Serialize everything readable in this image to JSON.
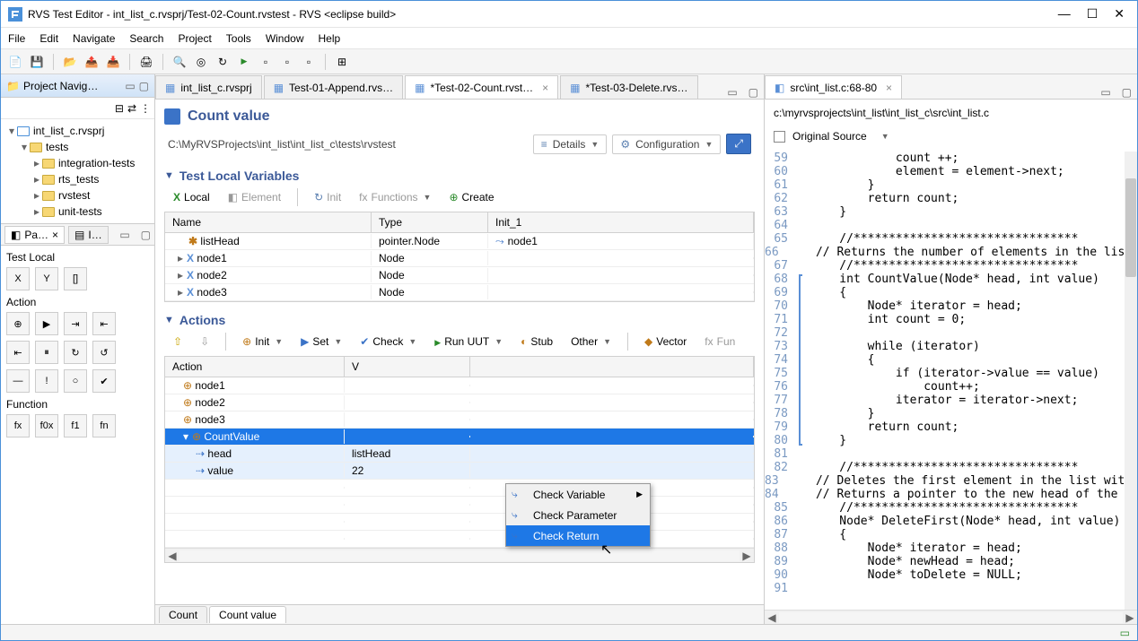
{
  "window": {
    "title": "RVS Test Editor - int_list_c.rvsprj/Test-02-Count.rvstest - RVS <eclipse build>"
  },
  "menu": [
    "File",
    "Edit",
    "Navigate",
    "Search",
    "Project",
    "Tools",
    "Window",
    "Help"
  ],
  "left_view": {
    "title": "Project Navig…",
    "tree": [
      {
        "level": 0,
        "exp": "▾",
        "icon": "proj",
        "label": "int_list_c.rvsprj"
      },
      {
        "level": 1,
        "exp": "▾",
        "icon": "folder",
        "label": "tests"
      },
      {
        "level": 2,
        "exp": "▸",
        "icon": "folder",
        "label": "integration-tests"
      },
      {
        "level": 2,
        "exp": "▸",
        "icon": "folder",
        "label": "rts_tests"
      },
      {
        "level": 2,
        "exp": "▸",
        "icon": "folder",
        "label": "rvstest"
      },
      {
        "level": 2,
        "exp": "▸",
        "icon": "folder",
        "label": "unit-tests"
      }
    ]
  },
  "lower_left": {
    "tabs": [
      {
        "label": "Pa…",
        "active": true
      },
      {
        "label": "I…",
        "active": false
      }
    ],
    "sections": {
      "test_local": "Test Local",
      "action": "Action",
      "function": "Function"
    },
    "row1": [
      "X",
      "Y",
      "[]"
    ],
    "row2": [
      "⊕",
      "▶",
      "⇥",
      "⇤"
    ],
    "row3": [
      "⇤",
      "⏸",
      "↻",
      "↺"
    ],
    "row4": [
      "—",
      "!",
      "○",
      "✔"
    ],
    "row5": [
      "fx",
      "f0x",
      "f1",
      "fn"
    ]
  },
  "editor_tabs": [
    {
      "label": "int_list_c.rvsprj",
      "active": false,
      "dirty": false
    },
    {
      "label": "Test-01-Append.rvs…",
      "active": false,
      "dirty": false
    },
    {
      "label": "*Test-02-Count.rvst…",
      "active": true,
      "dirty": true
    },
    {
      "label": "*Test-03-Delete.rvs…",
      "active": false,
      "dirty": true
    }
  ],
  "editor": {
    "title": "Count value",
    "path": "C:\\MyRVSProjects\\int_list\\int_list_c\\tests\\rvstest",
    "details_btn": "Details",
    "config_btn": "Configuration",
    "section_local": "Test Local Variables",
    "local_bar": {
      "local": "Local",
      "element": "Element",
      "init": "Init",
      "functions": "Functions",
      "create": "Create"
    },
    "local_cols": {
      "name": "Name",
      "type": "Type",
      "init": "Init_1"
    },
    "local_rows": [
      {
        "name": "listHead",
        "type": "pointer.Node",
        "init": "node1",
        "icon": "ptr"
      },
      {
        "name": "node1",
        "type": "Node",
        "init": "",
        "icon": "node",
        "exp": "▸"
      },
      {
        "name": "node2",
        "type": "Node",
        "init": "",
        "icon": "node",
        "exp": "▸"
      },
      {
        "name": "node3",
        "type": "Node",
        "init": "",
        "icon": "node",
        "exp": "▸"
      }
    ],
    "section_actions": "Actions",
    "actions_bar": {
      "init": "Init",
      "set": "Set",
      "check": "Check",
      "run": "Run UUT",
      "stub": "Stub",
      "other": "Other",
      "vector": "Vector",
      "fun": "Fun"
    },
    "actions_cols": {
      "action": "Action",
      "value": "V"
    },
    "actions_rows": [
      {
        "action": "node1",
        "value": "",
        "icon": "cog",
        "indent": 1
      },
      {
        "action": "node2",
        "value": "",
        "icon": "cog",
        "indent": 1
      },
      {
        "action": "node3",
        "value": "",
        "icon": "cog",
        "indent": 1
      },
      {
        "action": "CountValue",
        "value": "",
        "icon": "cog",
        "indent": 1,
        "selected": true,
        "exp": "▾"
      },
      {
        "action": "head",
        "value": "listHead",
        "icon": "arg",
        "indent": 2,
        "child": true
      },
      {
        "action": "value",
        "value": "22",
        "icon": "arg",
        "indent": 2,
        "child": true
      }
    ],
    "bottom_tabs": [
      "Count",
      "Count value"
    ]
  },
  "context_menu": {
    "items": [
      {
        "label": "Check Variable",
        "submenu": true
      },
      {
        "label": "Check Parameter"
      },
      {
        "label": "Check Return",
        "hover": true
      }
    ]
  },
  "right": {
    "tab": "src\\int_list.c:68-80",
    "path": "c:\\myrvsprojects\\int_list\\int_list_c\\src\\int_list.c",
    "orig_src": "Original Source",
    "lines": [
      {
        "n": 59,
        "t": "            count ++;"
      },
      {
        "n": 60,
        "t": "            element = element->next;"
      },
      {
        "n": 61,
        "t": "        }"
      },
      {
        "n": 62,
        "t": "        return count;"
      },
      {
        "n": 63,
        "t": "    }"
      },
      {
        "n": 64,
        "t": ""
      },
      {
        "n": 65,
        "t": "    //********************************",
        "c": true
      },
      {
        "n": 66,
        "t": "    // Returns the number of elements in the lis",
        "c": true
      },
      {
        "n": 67,
        "t": "    //********************************",
        "c": true
      },
      {
        "n": 68,
        "t": "    int CountValue(Node* head, int value)",
        "brace": "start"
      },
      {
        "n": 69,
        "t": "    {"
      },
      {
        "n": 70,
        "t": "        Node* iterator = head;"
      },
      {
        "n": 71,
        "t": "        int count = 0;"
      },
      {
        "n": 72,
        "t": ""
      },
      {
        "n": 73,
        "t": "        while (iterator)"
      },
      {
        "n": 74,
        "t": "        {"
      },
      {
        "n": 75,
        "t": "            if (iterator->value == value)"
      },
      {
        "n": 76,
        "t": "                count++;"
      },
      {
        "n": 77,
        "t": "            iterator = iterator->next;"
      },
      {
        "n": 78,
        "t": "        }"
      },
      {
        "n": 79,
        "t": "        return count;"
      },
      {
        "n": 80,
        "t": "    }",
        "brace": "end"
      },
      {
        "n": 81,
        "t": ""
      },
      {
        "n": 82,
        "t": "    //********************************",
        "c": true
      },
      {
        "n": 83,
        "t": "    // Deletes the first element in the list wit",
        "c": true
      },
      {
        "n": 84,
        "t": "    // Returns a pointer to the new head of the ",
        "c": true
      },
      {
        "n": 85,
        "t": "    //********************************",
        "c": true
      },
      {
        "n": 86,
        "t": "    Node* DeleteFirst(Node* head, int value)"
      },
      {
        "n": 87,
        "t": "    {"
      },
      {
        "n": 88,
        "t": "        Node* iterator = head;"
      },
      {
        "n": 89,
        "t": "        Node* newHead = head;"
      },
      {
        "n": 90,
        "t": "        Node* toDelete = NULL;"
      },
      {
        "n": 91,
        "t": ""
      }
    ]
  }
}
